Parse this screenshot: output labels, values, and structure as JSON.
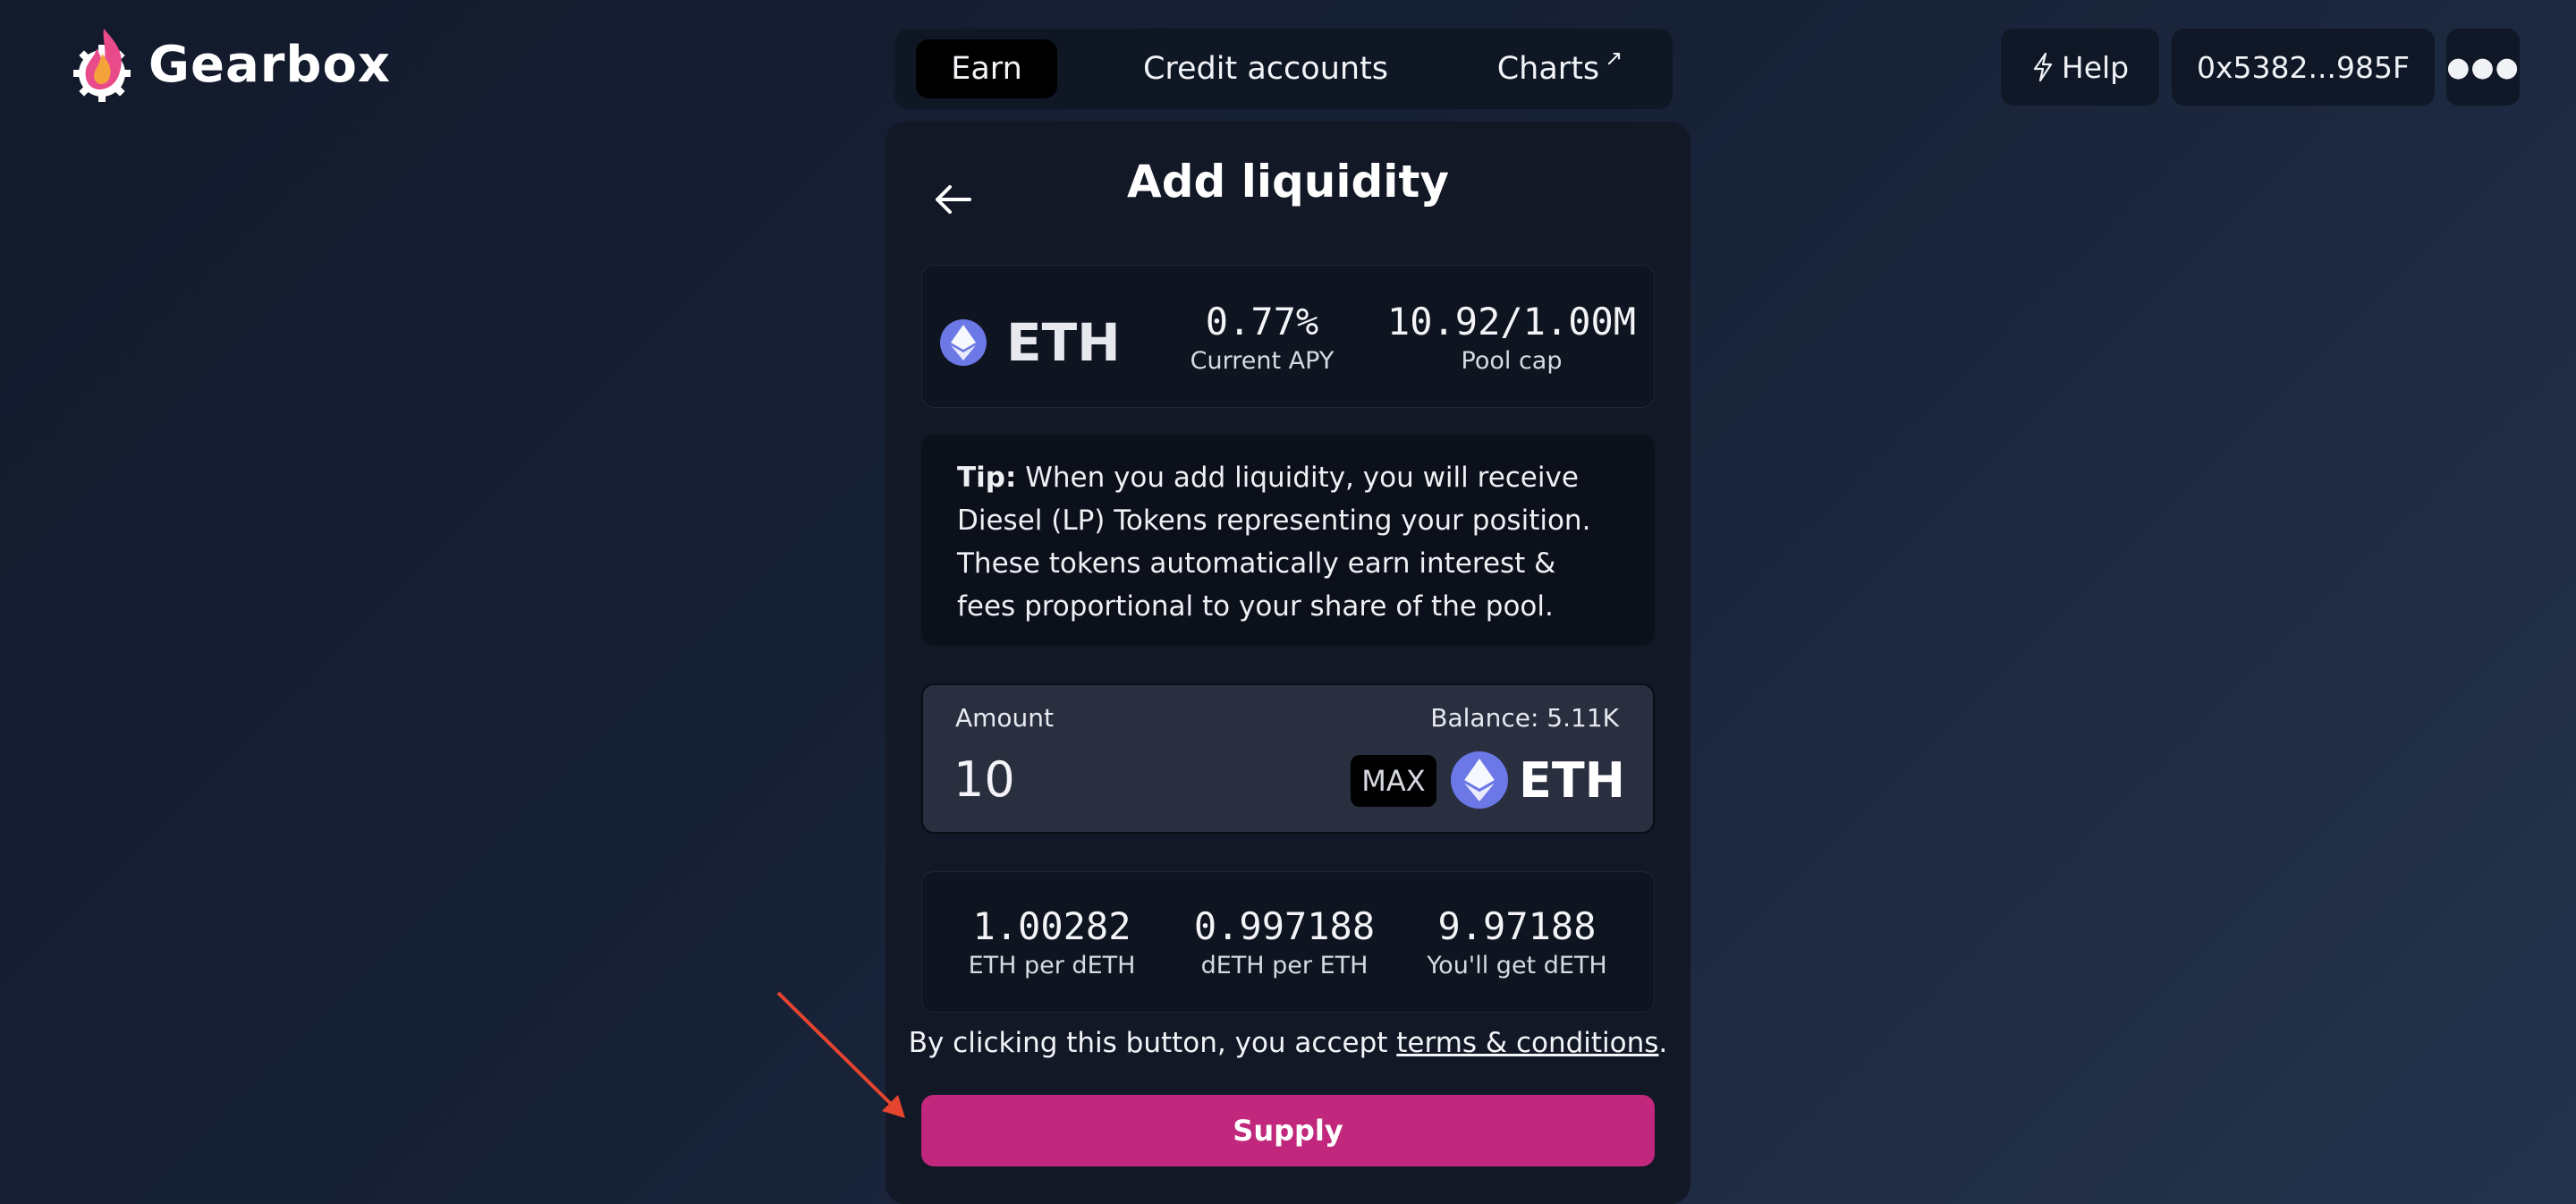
{
  "brand": {
    "name": "Gearbox"
  },
  "nav": {
    "tabs": [
      {
        "label": "Earn",
        "active": true
      },
      {
        "label": "Credit accounts"
      },
      {
        "label": "Charts",
        "icon": "external-link-icon"
      }
    ]
  },
  "header": {
    "help_label": "Help",
    "wallet_address": "0x5382...985F",
    "more_icon": "more-icon"
  },
  "card": {
    "title": "Add liquidity",
    "pool": {
      "token": "ETH",
      "apy_value": "0.77%",
      "apy_label": "Current APY",
      "cap_value": "10.92/1.00M",
      "cap_label": "Pool cap"
    },
    "tip": {
      "prefix": "Tip:",
      "text": " When you add liquidity, you will receive Diesel (LP) Tokens representing your position. These tokens automatically earn interest & fees proportional to your share of the pool."
    },
    "amount": {
      "label": "Amount",
      "balance": "Balance: 5.11K",
      "value": "10",
      "max_label": "MAX",
      "token": "ETH"
    },
    "rates": [
      {
        "value": "1.00282",
        "label": "ETH per dETH"
      },
      {
        "value": "0.997188",
        "label": "dETH per ETH"
      },
      {
        "value": "9.97188",
        "label": "You'll get dETH"
      }
    ],
    "terms": {
      "prefix": "By clicking this button, you accept ",
      "link": "terms & conditions",
      "suffix": "."
    },
    "supply_label": "Supply"
  },
  "colors": {
    "accent": "#c1277c",
    "annotation_arrow": "#e5452f",
    "eth": "#6b78e5"
  }
}
